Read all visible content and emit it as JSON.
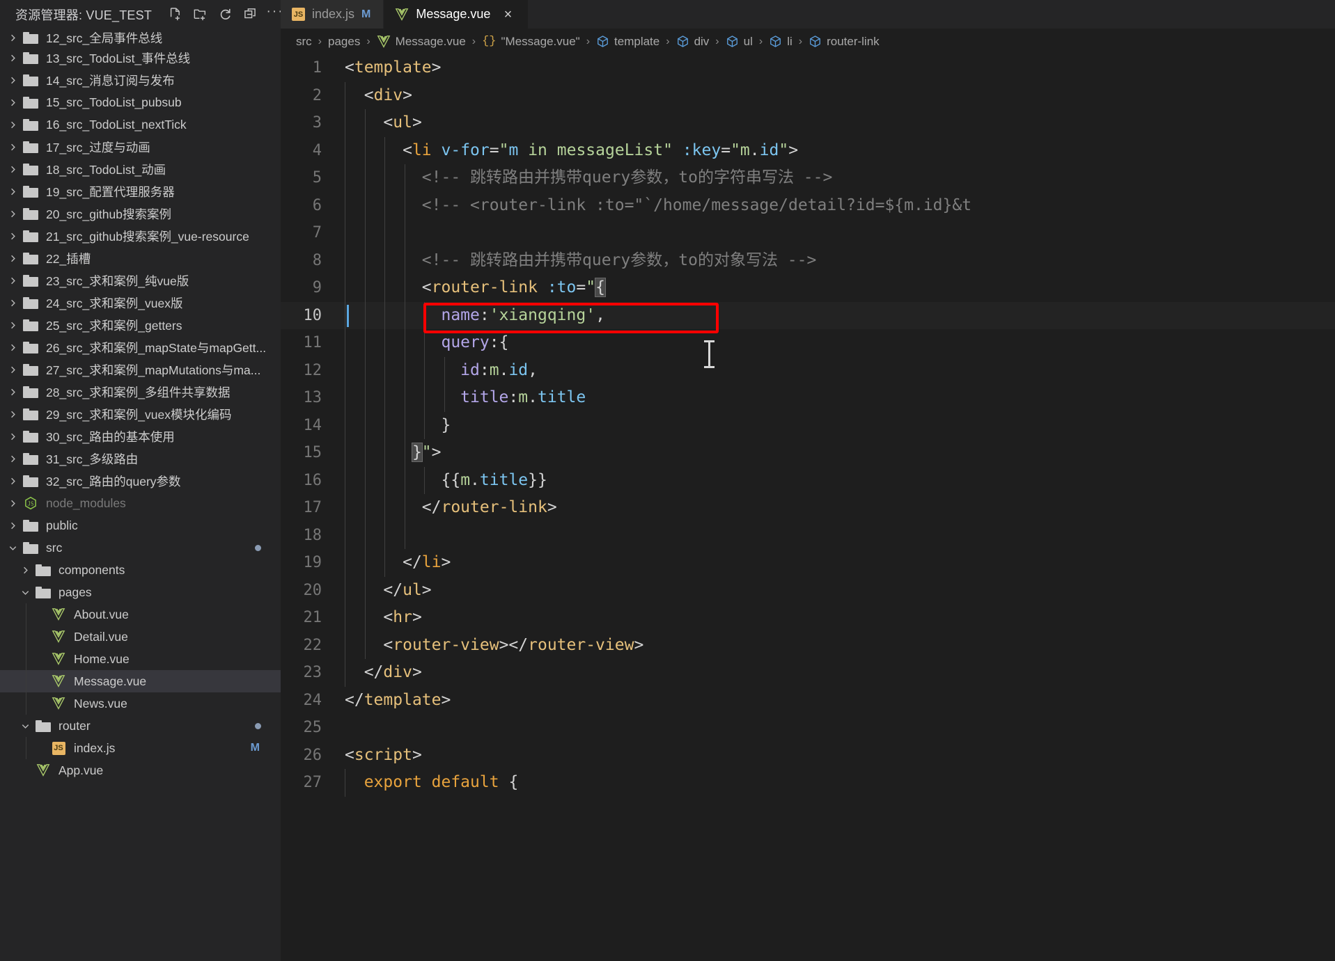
{
  "sidebar": {
    "title": "资源管理器: VUE_TEST",
    "actions": [
      {
        "name": "new-file-icon",
        "label": "新建文件"
      },
      {
        "name": "new-folder-icon",
        "label": "新建文件夹"
      },
      {
        "name": "refresh-icon",
        "label": "刷新"
      },
      {
        "name": "collapse-all-icon",
        "label": "折叠全部"
      },
      {
        "name": "more-actions-icon",
        "label": "···"
      }
    ],
    "items": [
      {
        "label": "12_src_全局事件总线",
        "type": "folder",
        "indent": 0,
        "expanded": false,
        "partial": true
      },
      {
        "label": "13_src_TodoList_事件总线",
        "type": "folder",
        "indent": 0,
        "expanded": false
      },
      {
        "label": "14_src_消息订阅与发布",
        "type": "folder",
        "indent": 0,
        "expanded": false
      },
      {
        "label": "15_src_TodoList_pubsub",
        "type": "folder",
        "indent": 0,
        "expanded": false
      },
      {
        "label": "16_src_TodoList_nextTick",
        "type": "folder",
        "indent": 0,
        "expanded": false
      },
      {
        "label": "17_src_过度与动画",
        "type": "folder",
        "indent": 0,
        "expanded": false
      },
      {
        "label": "18_src_TodoList_动画",
        "type": "folder",
        "indent": 0,
        "expanded": false
      },
      {
        "label": "19_src_配置代理服务器",
        "type": "folder",
        "indent": 0,
        "expanded": false
      },
      {
        "label": "20_src_github搜索案例",
        "type": "folder",
        "indent": 0,
        "expanded": false
      },
      {
        "label": "21_src_github搜索案例_vue-resource",
        "type": "folder",
        "indent": 0,
        "expanded": false
      },
      {
        "label": "22_插槽",
        "type": "folder",
        "indent": 0,
        "expanded": false
      },
      {
        "label": "23_src_求和案例_纯vue版",
        "type": "folder",
        "indent": 0,
        "expanded": false
      },
      {
        "label": "24_src_求和案例_vuex版",
        "type": "folder",
        "indent": 0,
        "expanded": false
      },
      {
        "label": "25_src_求和案例_getters",
        "type": "folder",
        "indent": 0,
        "expanded": false
      },
      {
        "label": "26_src_求和案例_mapState与mapGett...",
        "type": "folder",
        "indent": 0,
        "expanded": false
      },
      {
        "label": "27_src_求和案例_mapMutations与ma...",
        "type": "folder",
        "indent": 0,
        "expanded": false
      },
      {
        "label": "28_src_求和案例_多组件共享数据",
        "type": "folder",
        "indent": 0,
        "expanded": false
      },
      {
        "label": "29_src_求和案例_vuex模块化编码",
        "type": "folder",
        "indent": 0,
        "expanded": false
      },
      {
        "label": "30_src_路由的基本使用",
        "type": "folder",
        "indent": 0,
        "expanded": false
      },
      {
        "label": "31_src_多级路由",
        "type": "folder",
        "indent": 0,
        "expanded": false
      },
      {
        "label": "32_src_路由的query参数",
        "type": "folder",
        "indent": 0,
        "expanded": false
      },
      {
        "label": "node_modules",
        "type": "node",
        "indent": 0,
        "expanded": false,
        "dim": true
      },
      {
        "label": "public",
        "type": "folder",
        "indent": 0,
        "expanded": false
      },
      {
        "label": "src",
        "type": "folder",
        "indent": 0,
        "expanded": true,
        "dot": true
      },
      {
        "label": "components",
        "type": "folder",
        "indent": 1,
        "expanded": false
      },
      {
        "label": "pages",
        "type": "folder",
        "indent": 1,
        "expanded": true
      },
      {
        "label": "About.vue",
        "type": "vue",
        "indent": 2
      },
      {
        "label": "Detail.vue",
        "type": "vue",
        "indent": 2
      },
      {
        "label": "Home.vue",
        "type": "vue",
        "indent": 2
      },
      {
        "label": "Message.vue",
        "type": "vue",
        "indent": 2,
        "selected": true
      },
      {
        "label": "News.vue",
        "type": "vue",
        "indent": 2
      },
      {
        "label": "router",
        "type": "folder",
        "indent": 1,
        "expanded": true,
        "dot": true
      },
      {
        "label": "index.js",
        "type": "js",
        "indent": 2,
        "badge": "M"
      },
      {
        "label": "App.vue",
        "type": "vue",
        "indent": 1
      }
    ]
  },
  "tabs": [
    {
      "name": "index.js",
      "icon": "js-icon",
      "modified": "M",
      "active": false
    },
    {
      "name": "Message.vue",
      "icon": "vue-icon",
      "modified": "",
      "active": true,
      "closable": true
    }
  ],
  "breadcrumb": [
    {
      "text": "src",
      "icon": ""
    },
    {
      "text": "pages",
      "icon": ""
    },
    {
      "text": "Message.vue",
      "icon": "vue-icon"
    },
    {
      "text": "\"Message.vue\"",
      "icon": "braces-icon"
    },
    {
      "text": "template",
      "icon": "symbol-cube-icon"
    },
    {
      "text": "div",
      "icon": "symbol-cube-icon"
    },
    {
      "text": "ul",
      "icon": "symbol-cube-icon"
    },
    {
      "text": "li",
      "icon": "symbol-cube-icon"
    },
    {
      "text": "router-link",
      "icon": "symbol-cube-icon"
    }
  ],
  "editor": {
    "file": "Message.vue",
    "active_line": 10,
    "lines": [
      {
        "n": 1,
        "html": "<span class='t-punc'>&lt;</span><span class='t-tag'>template</span><span class='t-punc'>&gt;</span>",
        "indent": 0
      },
      {
        "n": 2,
        "html": "  <span class='t-punc'>&lt;</span><span class='t-tag'>div</span><span class='t-punc'>&gt;</span>",
        "indent": 1
      },
      {
        "n": 3,
        "html": "    <span class='t-punc'>&lt;</span><span class='t-tag'>ul</span><span class='t-punc'>&gt;</span>",
        "indent": 2
      },
      {
        "n": 4,
        "html": "      <span class='t-punc'>&lt;</span><span class='t-tagn'>li</span> <span class='t-attr'>v-for</span><span class='t-punc'>=</span><span class='t-str'>\"</span><span class='t-attr'>m</span> <span class='t-str'>in</span> <span class='t-green'>messageList</span><span class='t-str'>\"</span> <span class='t-attr'>:key</span><span class='t-punc'>=</span><span class='t-str'>\"</span><span class='t-green'>m</span><span class='t-punc'>.</span><span class='t-var'>id</span><span class='t-str'>\"</span><span class='t-punc'>&gt;</span>",
        "indent": 3
      },
      {
        "n": 5,
        "html": "        <span class='t-cmt'>&lt;!-- 跳转路由并携带query参数，to的字符串写法 --&gt;</span>",
        "indent": 4
      },
      {
        "n": 6,
        "html": "        <span class='t-cmt'>&lt;!-- &lt;router-link :to=\"`/home/message/detail?id=${m.id}&amp;t</span>",
        "indent": 4
      },
      {
        "n": 7,
        "html": "",
        "indent": 4
      },
      {
        "n": 8,
        "html": "        <span class='t-cmt'>&lt;!-- 跳转路由并携带query参数，to的对象写法 --&gt;</span>",
        "indent": 4
      },
      {
        "n": 9,
        "html": "        <span class='t-punc'>&lt;</span><span class='t-tag'>router-link</span> <span class='t-attr'>:to</span><span class='t-punc'>=</span><span class='t-str'>\"</span><span class='bracket-hl t-punc'>{</span>",
        "indent": 4
      },
      {
        "n": 10,
        "html": "          <span class='t-prop'>name</span><span class='t-punc'>:</span><span class='t-str'>'xiangqing'</span><span class='t-punc'>,</span>",
        "indent": 5
      },
      {
        "n": 11,
        "html": "          <span class='t-prop'>query</span><span class='t-punc'>:{</span>",
        "indent": 5
      },
      {
        "n": 12,
        "html": "            <span class='t-prop'>id</span><span class='t-punc'>:</span><span class='t-green'>m</span><span class='t-punc'>.</span><span class='t-var'>id</span><span class='t-punc'>,</span>",
        "indent": 6
      },
      {
        "n": 13,
        "html": "            <span class='t-prop'>title</span><span class='t-punc'>:</span><span class='t-green'>m</span><span class='t-punc'>.</span><span class='t-var'>title</span>",
        "indent": 6
      },
      {
        "n": 14,
        "html": "          <span class='t-punc'>}</span>",
        "indent": 5
      },
      {
        "n": 15,
        "html": "       <span class='bracket-hl t-punc'>}</span><span class='t-str'>\"</span><span class='t-punc'>&gt;</span>",
        "indent": 4
      },
      {
        "n": 16,
        "html": "          <span class='t-punc'>{{</span><span class='t-green'>m</span><span class='t-punc'>.</span><span class='t-var'>title</span><span class='t-punc'>}}</span>",
        "indent": 5
      },
      {
        "n": 17,
        "html": "        <span class='t-punc'>&lt;/</span><span class='t-tag'>router-link</span><span class='t-punc'>&gt;</span>",
        "indent": 4
      },
      {
        "n": 18,
        "html": "",
        "indent": 4
      },
      {
        "n": 19,
        "html": "      <span class='t-punc'>&lt;/</span><span class='t-tagn'>li</span><span class='t-punc'>&gt;</span>",
        "indent": 3
      },
      {
        "n": 20,
        "html": "    <span class='t-punc'>&lt;/</span><span class='t-tag'>ul</span><span class='t-punc'>&gt;</span>",
        "indent": 2
      },
      {
        "n": 21,
        "html": "    <span class='t-punc'>&lt;</span><span class='t-tag'>hr</span><span class='t-punc'>&gt;</span>",
        "indent": 2
      },
      {
        "n": 22,
        "html": "    <span class='t-punc'>&lt;</span><span class='t-tag'>router-view</span><span class='t-punc'>&gt;&lt;/</span><span class='t-tag'>router-view</span><span class='t-punc'>&gt;</span>",
        "indent": 2
      },
      {
        "n": 23,
        "html": "  <span class='t-punc'>&lt;/</span><span class='t-tag'>div</span><span class='t-punc'>&gt;</span>",
        "indent": 1
      },
      {
        "n": 24,
        "html": "<span class='t-punc'>&lt;/</span><span class='t-tag'>template</span><span class='t-punc'>&gt;</span>",
        "indent": 0
      },
      {
        "n": 25,
        "html": "",
        "indent": 0
      },
      {
        "n": 26,
        "html": "<span class='t-punc'>&lt;</span><span class='t-tag'>script</span><span class='t-punc'>&gt;</span>",
        "indent": 0
      },
      {
        "n": 27,
        "html": "  <span class='t-kw'>export default</span> <span class='t-punc'>{</span>",
        "indent": 1
      }
    ],
    "annotation": {
      "type": "red-rectangle",
      "color": "#ff0000",
      "target_line": 10,
      "target_text": "name:'xiangqing',"
    },
    "text_cursor": {
      "line": 10,
      "column": 1
    }
  },
  "colors": {
    "editor_bg": "#1e1e1e",
    "sidebar_bg": "#252526",
    "selection": "#37373d",
    "accent_red": "#ff0000",
    "cursor_blue": "#5aa7e0",
    "modified_green": "#73c991"
  }
}
